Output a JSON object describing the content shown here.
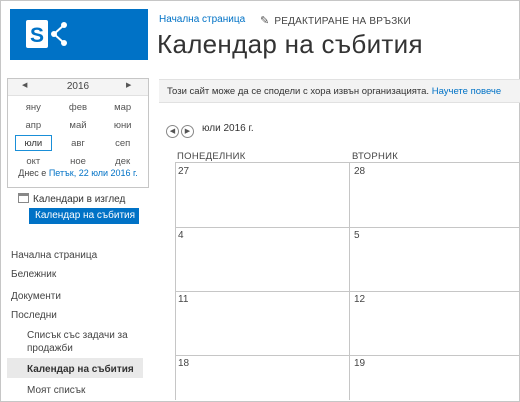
{
  "header": {
    "home_link": "Начална страница",
    "edit_links": "РЕДАКТИРАНЕ НА ВРЪЗКИ",
    "page_title": "Календар на събития"
  },
  "notice": {
    "text": "Този сайт може да се сподели с хора извън организацията.",
    "link": "Научете повече"
  },
  "mini_calendar": {
    "year": "2016",
    "months": [
      "яну",
      "фев",
      "мар",
      "апр",
      "май",
      "юни",
      "юли",
      "авг",
      "сеп",
      "окт",
      "ное",
      "дек"
    ],
    "selected_month": "юли",
    "today_prefix": "Днес е",
    "today_link": "Петък, 22 юли 2016 г."
  },
  "calendars_in_view": {
    "label": "Календари в изглед",
    "current": "Календар на събития"
  },
  "quick_launch": {
    "items": [
      "Начална страница",
      "Бележник",
      "Документи",
      "Последни"
    ],
    "recent": [
      "Списък със задачи за продажби",
      "Календар на събития",
      "Моят списък"
    ]
  },
  "calendar": {
    "month_label": "юли 2016 г.",
    "day_headers": [
      "ПОНЕДЕЛНИК",
      "ВТОРНИК"
    ],
    "rows": [
      [
        "27",
        "28"
      ],
      [
        "4",
        "5"
      ],
      [
        "11",
        "12"
      ],
      [
        "18",
        "19"
      ]
    ]
  },
  "colors": {
    "accent": "#0072c6",
    "selected_border": "#1a8fd8",
    "notice_bg": "#f3f3f3"
  }
}
